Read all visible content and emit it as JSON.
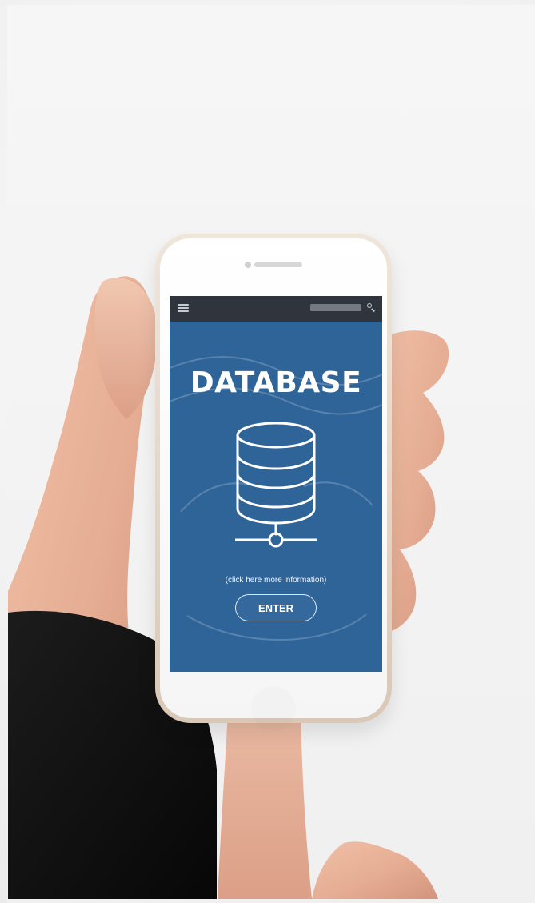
{
  "screen": {
    "title": "DATABASE",
    "info_text": "(click here more information)",
    "enter_label": "ENTER"
  },
  "icons": {
    "menu": "hamburger-menu-icon",
    "search": "search-icon",
    "database": "database-icon"
  },
  "colors": {
    "screen_blue": "#2f6499",
    "topbar_dark": "#30343c",
    "phone_gold": "#d9c8b6",
    "sleeve_black": "#111111",
    "skin": "#e7b39a"
  }
}
